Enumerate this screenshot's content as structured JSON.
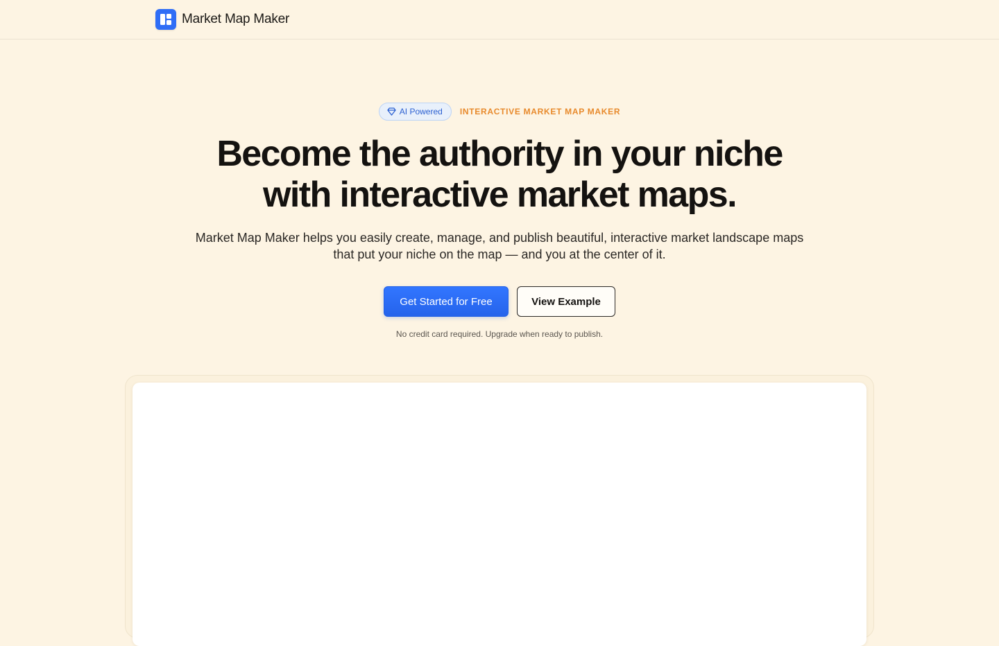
{
  "header": {
    "brand_name": "Market Map Maker",
    "logo_icon": "grid-layout-icon",
    "accent_color": "#2f6df6"
  },
  "hero": {
    "ai_badge": {
      "label": "AI Powered",
      "icon": "diamond-icon"
    },
    "eyebrow": "INTERACTIVE MARKET MAP MAKER",
    "headline_line1": "Become the authority in your niche",
    "headline_line2": "with interactive market maps.",
    "subtext_line1": "Market Map Maker helps you easily create, manage, and publish beautiful, interactive market landscape maps",
    "subtext_line2": "that put your niche on the map — and you at the center of it.",
    "primary_cta": "Get Started for Free",
    "secondary_cta": "View Example",
    "fineprint": "No credit card required. Upgrade when ready to publish."
  },
  "colors": {
    "background": "#fdf4e3",
    "primary_button": "#2563eb",
    "eyebrow": "#e88a2c",
    "badge_text": "#2a5fd1"
  }
}
